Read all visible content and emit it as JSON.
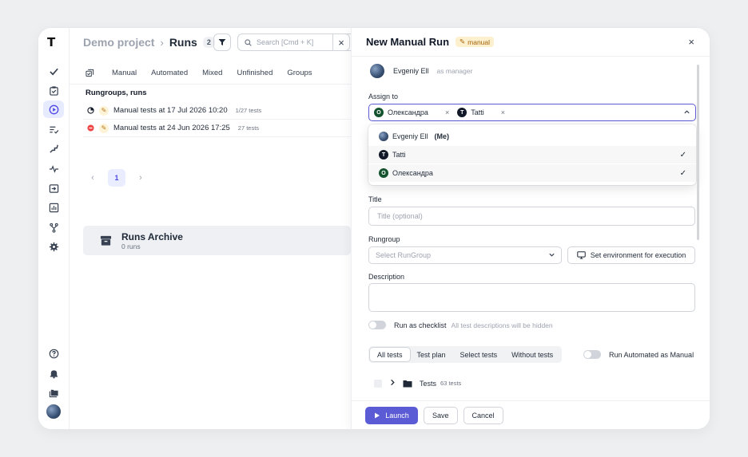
{
  "sidebar": {
    "logo": "T",
    "items": [
      {
        "icon": "check-icon"
      },
      {
        "icon": "clipboard-check-icon"
      },
      {
        "icon": "play-circle-icon"
      },
      {
        "icon": "list-check-icon"
      },
      {
        "icon": "steps-icon"
      },
      {
        "icon": "pulse-icon"
      },
      {
        "icon": "import-icon"
      },
      {
        "icon": "analytics-icon"
      },
      {
        "icon": "branch-icon"
      },
      {
        "icon": "settings-gear-icon"
      }
    ],
    "bottom": [
      {
        "icon": "help-circle-icon"
      },
      {
        "icon": "bell-icon"
      },
      {
        "icon": "folders-icon"
      },
      {
        "icon": "user-avatar"
      }
    ]
  },
  "header": {
    "project": "Demo project",
    "separator": "›",
    "page": "Runs",
    "count": "2",
    "search_placeholder": "Search [Cmd + K]"
  },
  "tabs": [
    "Manual",
    "Automated",
    "Mixed",
    "Unfinished",
    "Groups"
  ],
  "section_title": "Rungroups, runs",
  "runs": [
    {
      "name": "Manual tests at 17 Jul 2026 10:20",
      "count": "1/27 tests",
      "status_color": "#111827"
    },
    {
      "name": "Manual tests at 24 Jun 2026 17:25",
      "count": "27 tests",
      "status_color": "#ef4444"
    }
  ],
  "pagination": {
    "prev": "‹",
    "page": "1",
    "next": "›"
  },
  "archive": {
    "title": "Runs Archive",
    "subtitle": "0 runs"
  },
  "panel": {
    "title": "New Manual Run",
    "badge": "manual",
    "close": "×",
    "manager": {
      "name": "Evgeniy Ell",
      "role": "as manager"
    },
    "assign_label": "Assign to",
    "assigned": [
      {
        "initial": "О",
        "name": "Олександра"
      },
      {
        "initial": "T",
        "name": "Tatti"
      }
    ],
    "dropdown": [
      {
        "name": "Evgeniy Ell",
        "suffix": "(Me)",
        "checked": false
      },
      {
        "initial": "T",
        "name": "Tatti",
        "checked": true
      },
      {
        "initial": "О",
        "name": "Олександра",
        "checked": true
      }
    ],
    "title_label": "Title",
    "title_placeholder": "Title (optional)",
    "rungroup_label": "Rungroup",
    "rungroup_placeholder": "Select RunGroup",
    "env_button": "Set environment for execution",
    "description_label": "Description",
    "checklist_label": "Run as checklist",
    "checklist_hint": "All test descriptions will be hidden",
    "segments": [
      "All tests",
      "Test plan",
      "Select tests",
      "Without tests"
    ],
    "run_automated_label": "Run Automated as Manual",
    "tree": {
      "name": "Tests",
      "count": "63 tests"
    },
    "buttons": {
      "launch": "Launch",
      "save": "Save",
      "cancel": "Cancel"
    }
  },
  "colors": {
    "accent": "#5b5bd6",
    "active_nav_bg": "#e7ebff"
  }
}
